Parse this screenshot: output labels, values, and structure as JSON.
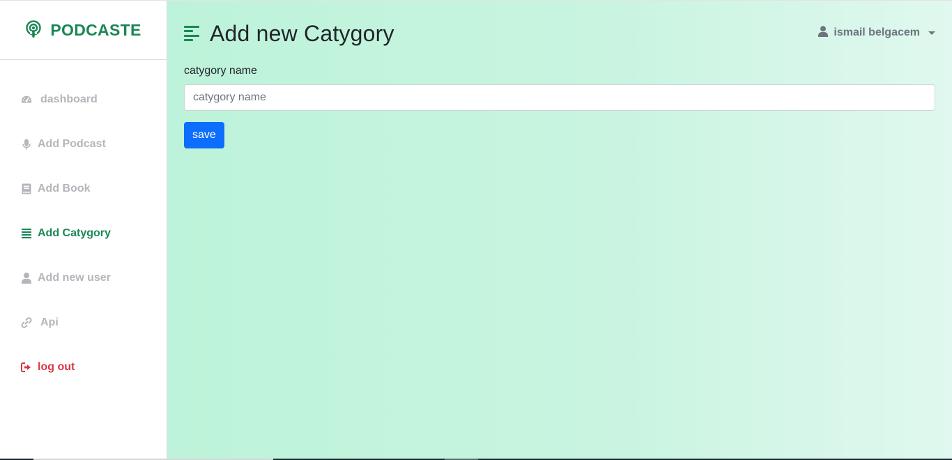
{
  "brand": {
    "name": "PODCASTE",
    "icon": "podcast-icon",
    "color": "#198754"
  },
  "sidebar": {
    "items": [
      {
        "label": "dashboard",
        "icon": "tachometer-icon",
        "state": "default"
      },
      {
        "label": "Add Podcast",
        "icon": "microphone-icon",
        "state": "default"
      },
      {
        "label": "Add Book",
        "icon": "book-icon",
        "state": "default"
      },
      {
        "label": "Add Catygory",
        "icon": "list-icon",
        "state": "active"
      },
      {
        "label": "Add new user",
        "icon": "user-icon",
        "state": "default"
      },
      {
        "label": "Api",
        "icon": "link-icon",
        "state": "default"
      },
      {
        "label": "log out",
        "icon": "sign-out-icon",
        "state": "danger"
      }
    ]
  },
  "header": {
    "title": "Add new Catygory",
    "toggle_icon": "align-left-icon",
    "user_name": "ismail belgacem",
    "user_icon": "user-icon"
  },
  "form": {
    "label": "catygory name",
    "input_value": "",
    "input_placeholder": "catygory name",
    "save_label": "save"
  },
  "colors": {
    "accent": "#198754",
    "primary_button": "#0d6efd",
    "danger": "#dc3545",
    "muted": "#b3b7bb"
  }
}
